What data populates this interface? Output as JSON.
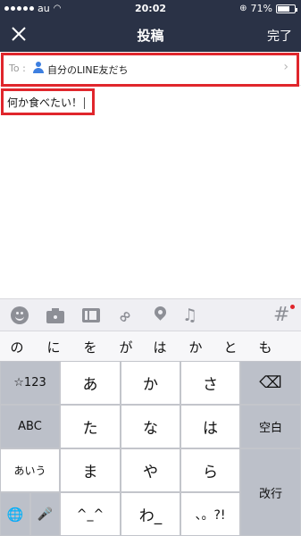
{
  "status_bar": {
    "carrier": "au",
    "time": "20:02",
    "battery": "71%",
    "battery_level": 0.71
  },
  "nav": {
    "title": "投稿",
    "done_label": "完了"
  },
  "to_row": {
    "label": "To :",
    "target": "自分のLINE友だち",
    "chevron": "›"
  },
  "post": {
    "text": "何か食べたい！"
  },
  "toolbar": {
    "icons": [
      "emoji-icon",
      "camera-icon",
      "video-icon",
      "link-icon",
      "location-icon",
      "music-icon",
      "hashtag-icon"
    ],
    "link_glyph": "∞",
    "music_glyph": "♫",
    "hashtag_glyph": "#"
  },
  "candidates": [
    "の",
    "に",
    "を",
    "が",
    "は",
    "か",
    "と",
    "も"
  ],
  "keyboard": {
    "symbols_key": "☆123",
    "abc_key": "ABC",
    "aiu_key": "あいう",
    "grid": [
      "あ",
      "か",
      "さ",
      "た",
      "な",
      "は",
      "ま",
      "や",
      "ら",
      "^_^",
      "わ_",
      "、。?!"
    ],
    "space_key": "空白",
    "return_key": "改行",
    "delete_glyph": "⌫",
    "globe_glyph": "🌐",
    "mic_glyph": "🎤"
  },
  "colors": {
    "nav_bg": "#2a3246",
    "highlight": "#e0262c",
    "keyboard_bg": "#d1d3d9"
  }
}
